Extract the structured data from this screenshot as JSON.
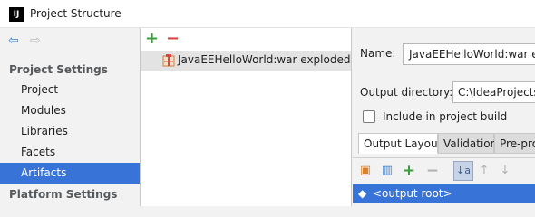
{
  "window": {
    "title": "Project Structure",
    "app_icon_text": "IJ"
  },
  "nav": {
    "back_icon": "back-arrow-icon",
    "forward_icon": "forward-arrow-icon",
    "project_settings_header": "Project Settings",
    "items": [
      {
        "label": "Project",
        "selected": false
      },
      {
        "label": "Modules",
        "selected": false
      },
      {
        "label": "Libraries",
        "selected": false
      },
      {
        "label": "Facets",
        "selected": false
      },
      {
        "label": "Artifacts",
        "selected": true
      }
    ],
    "platform_settings_header": "Platform Settings"
  },
  "artifacts": {
    "add_symbol": "+",
    "remove_symbol": "−",
    "selected_artifact": "JavaEEHelloWorld:war exploded"
  },
  "details": {
    "name_label": "Name:",
    "name_value": "JavaEEHelloWorld:war exploded",
    "output_directory_label": "Output directory:",
    "output_directory_value": "C:\\IdeaProjects\\",
    "include_in_build_label": "Include in project build",
    "include_in_build_checked": false,
    "tabs": [
      {
        "label": "Output Layout",
        "active": true
      },
      {
        "label": "Validation",
        "active": false
      },
      {
        "label": "Pre-pro",
        "active": false
      }
    ],
    "tree_root": "<output root>"
  },
  "colors": {
    "selection_blue": "#3874d8",
    "add_green": "#3f9b3f",
    "remove_red": "#d94545"
  }
}
